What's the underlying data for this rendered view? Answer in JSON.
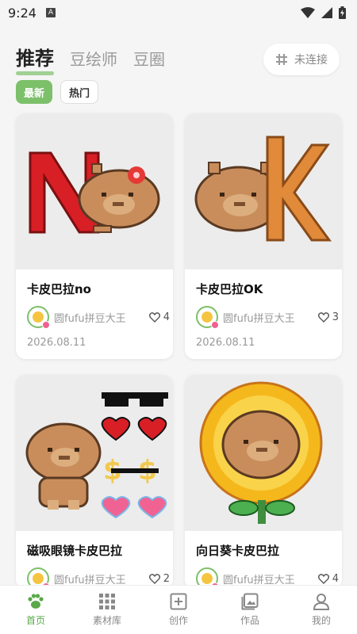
{
  "status_bar": {
    "time": "9:24",
    "notif_glyph": "A"
  },
  "tabs": [
    {
      "label": "推荐",
      "active": true
    },
    {
      "label": "豆绘师",
      "active": false
    },
    {
      "label": "豆圈",
      "active": false
    }
  ],
  "connect_button": {
    "label": "未连接",
    "icon": "grid-hash-icon"
  },
  "filters": [
    {
      "label": "最新",
      "active": true
    },
    {
      "label": "热门",
      "active": false
    }
  ],
  "cards": [
    {
      "title": "卡皮巴拉no",
      "author": "圆fufu拼豆大王",
      "likes": "4",
      "date": "2026.08.11"
    },
    {
      "title": "卡皮巴拉OK",
      "author": "圆fufu拼豆大王",
      "likes": "3",
      "date": "2026.08.11"
    },
    {
      "title": "磁吸眼镜卡皮巴拉",
      "author": "圆fufu拼豆大王",
      "likes": "2",
      "date": ""
    },
    {
      "title": "向日葵卡皮巴拉",
      "author": "圆fufu拼豆大王",
      "likes": "4",
      "date": ""
    }
  ],
  "bottom_nav": [
    {
      "label": "首页",
      "icon": "paw-icon",
      "active": true
    },
    {
      "label": "素材库",
      "icon": "grid-icon",
      "active": false
    },
    {
      "label": "创作",
      "icon": "plus-square-icon",
      "active": false
    },
    {
      "label": "作品",
      "icon": "gallery-icon",
      "active": false
    },
    {
      "label": "我的",
      "icon": "person-icon",
      "active": false
    }
  ],
  "colors": {
    "accent": "#7cc06a",
    "background": "#f5f5f5",
    "card": "#ffffff"
  }
}
